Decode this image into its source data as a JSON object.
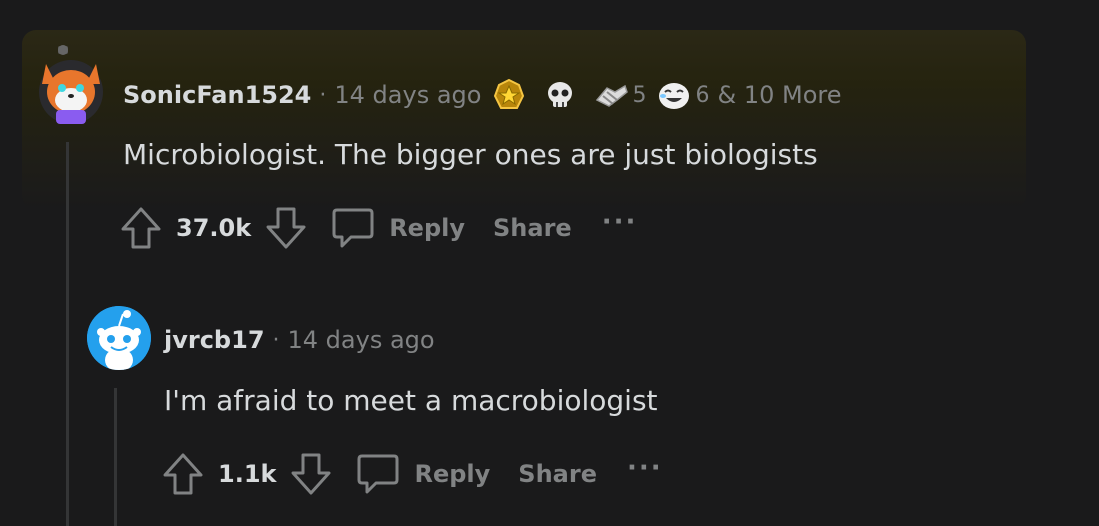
{
  "comments": [
    {
      "username": "SonicFan1524",
      "separator": "·",
      "time": "14 days ago",
      "awards": [
        {
          "icon": "gold-star-award-icon",
          "count": ""
        },
        {
          "icon": "skull-award-icon",
          "count": ""
        },
        {
          "icon": "handshake-award-icon",
          "count": "5"
        },
        {
          "icon": "laughing-face-award-icon",
          "count": "6"
        }
      ],
      "more_awards": "& 10 More",
      "body": "Microbiologist. The bigger ones are just biologists",
      "score": "37.0k",
      "reply_label": "Reply",
      "share_label": "Share",
      "more_label": "···",
      "highlight_color": "#2b2816"
    },
    {
      "username": "jvrcb17",
      "separator": "·",
      "time": "14 days ago",
      "body": "I'm afraid to meet a macrobiologist",
      "score": "1.1k",
      "reply_label": "Reply",
      "share_label": "Share",
      "more_label": "···",
      "avatar_color": "#24a0ed"
    }
  ],
  "colors": {
    "background": "#1a1a1b",
    "text_primary": "#d7dadc",
    "text_secondary": "#818384",
    "thread_line": "#343536"
  }
}
